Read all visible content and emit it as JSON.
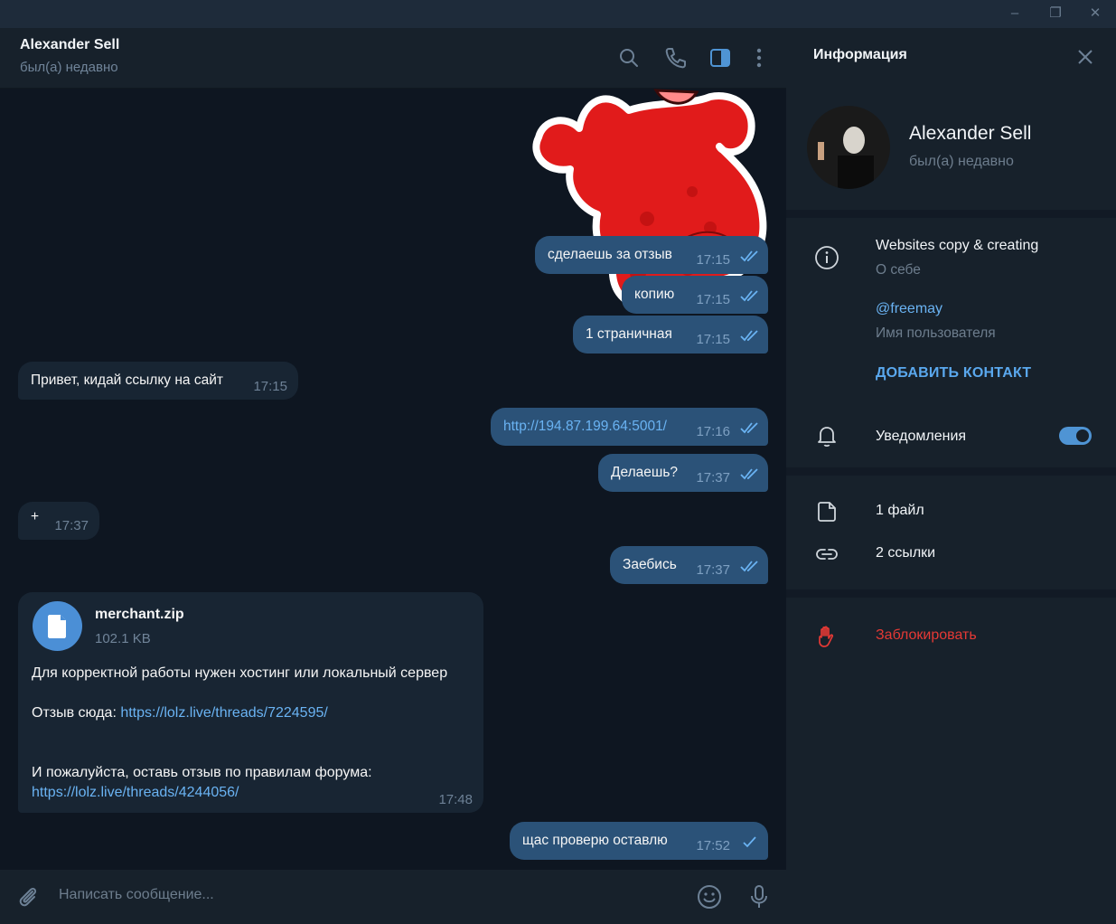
{
  "chat": {
    "name": "Alexander Sell",
    "status": "был(а) недавно"
  },
  "messages": [
    {
      "dir": "out",
      "text": "сделаешь за отзыв",
      "time": "17:15",
      "read": true
    },
    {
      "dir": "out",
      "text": "копию",
      "time": "17:15",
      "read": true
    },
    {
      "dir": "out",
      "text": "1 страничная",
      "time": "17:15",
      "read": true
    },
    {
      "dir": "in",
      "text": "Привет, кидай ссылку на сайт",
      "time": "17:15"
    },
    {
      "dir": "out",
      "text": "http://194.87.199.64:5001/",
      "time": "17:16",
      "read": true
    },
    {
      "dir": "out",
      "text": "Делаешь?",
      "time": "17:37",
      "read": true
    },
    {
      "dir": "in",
      "text": "+",
      "time": "17:37"
    },
    {
      "dir": "out",
      "text": "Заебись",
      "time": "17:37",
      "read": true
    },
    {
      "dir": "out",
      "text": "щас проверю оставлю",
      "time": "17:52",
      "read": false
    }
  ],
  "file_message": {
    "file_name": "merchant.zip",
    "file_size": "102.1 KB",
    "line1": "Для корректной работы нужен хостинг или локальный сервер",
    "line2_prefix": "Отзыв сюда: ",
    "line2_link": "https://lolz.live/threads/7224595/",
    "line3": "И пожалуйста, оставь отзыв по правилам форума:",
    "line4_link": "https://lolz.live/threads/4244056/",
    "time": "17:48"
  },
  "composer": {
    "placeholder": "Написать сообщение..."
  },
  "info": {
    "title": "Информация",
    "name": "Alexander Sell",
    "status": "был(а) недавно",
    "bio": "Websites copy & creating",
    "bio_label": "О себе",
    "username": "@freemay",
    "username_label": "Имя пользователя",
    "add_contact": "ДОБАВИТЬ КОНТАКТ",
    "notifications": "Уведомления",
    "notifications_on": true,
    "files": "1 файл",
    "links": "2 ссылки",
    "block": "Заблокировать"
  },
  "colors": {
    "background": "#0e1621",
    "panel": "#17212b",
    "bubble_out": "#2b5278",
    "bubble_in": "#182533",
    "accent": "#6ab3f3",
    "danger": "#e53935"
  },
  "icons": [
    "search-icon",
    "phone-icon",
    "sidebar-toggle-icon",
    "more-icon",
    "close-icon",
    "attach-icon",
    "emoji-icon",
    "microphone-icon",
    "info-icon",
    "bell-icon",
    "file-icon",
    "link-icon",
    "hand-stop-icon",
    "double-check-icon",
    "check-icon",
    "document-icon"
  ]
}
